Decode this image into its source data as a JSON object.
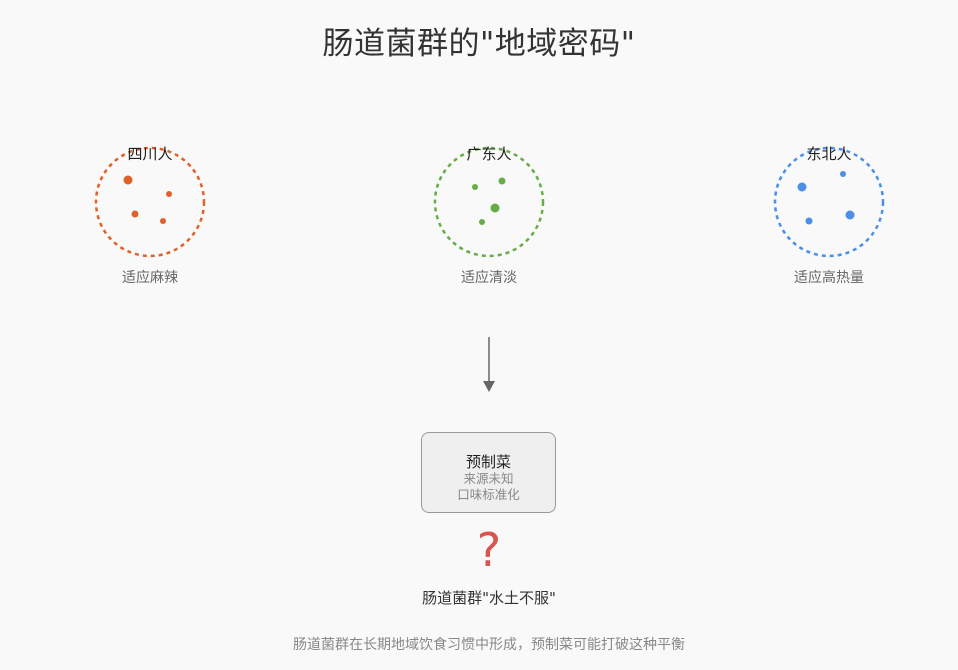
{
  "title": "肠道菌群的\"地域密码\"",
  "groups": [
    {
      "label": "四川人",
      "desc": "适应麻辣",
      "color": "#e0622a"
    },
    {
      "label": "广东人",
      "desc": "适应清淡",
      "color": "#67ad47"
    },
    {
      "label": "东北人",
      "desc": "适应高热量",
      "color": "#4b8fe6"
    }
  ],
  "box": {
    "title": "预制菜",
    "line1": "来源未知",
    "line2": "口味标准化"
  },
  "question_mark": "?",
  "result": "肠道菌群\"水土不服\"",
  "footer": "肠道菌群在长期地域饮食习惯中形成，预制菜可能打破这种平衡",
  "colors": {
    "question": "#d9534f",
    "arrow": "#666666"
  }
}
